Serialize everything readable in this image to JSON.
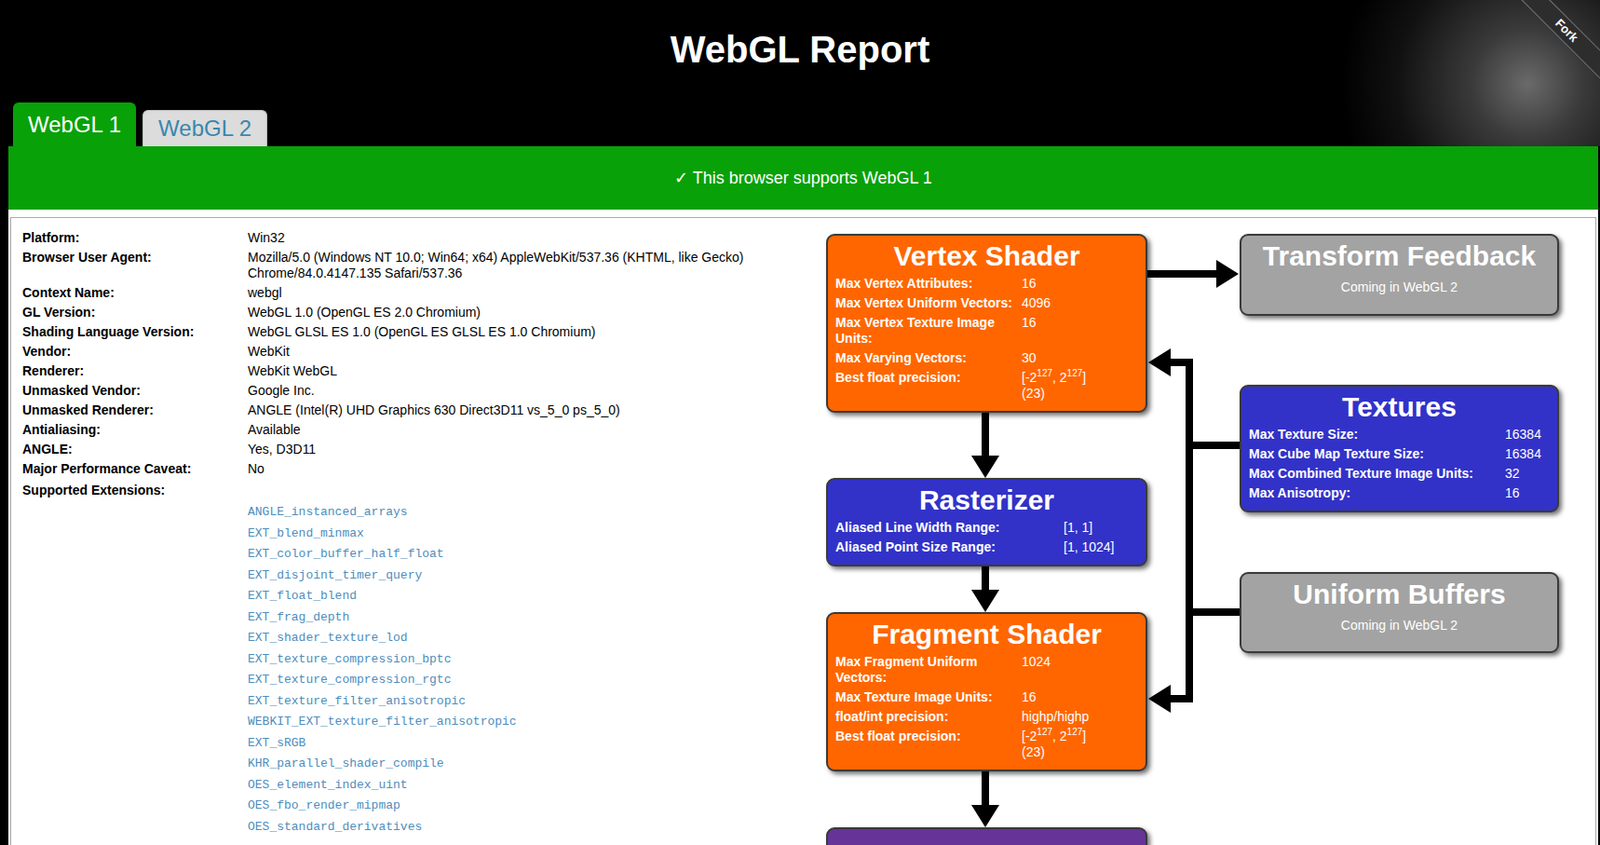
{
  "page": {
    "title": "WebGL Report",
    "ribbon": "Fork"
  },
  "tabs": [
    {
      "label": "WebGL 1",
      "selected": true
    },
    {
      "label": "WebGL 2",
      "selected": false
    }
  ],
  "banner": "✓ This browser supports WebGL 1",
  "info": [
    {
      "label": "Platform:",
      "value": "Win32"
    },
    {
      "label": "Browser User Agent:",
      "value": "Mozilla/5.0 (Windows NT 10.0; Win64; x64) AppleWebKit/537.36 (KHTML, like Gecko) Chrome/84.0.4147.135 Safari/537.36"
    },
    {
      "label": "Context Name:",
      "value": "webgl"
    },
    {
      "label": "GL Version:",
      "value": "WebGL 1.0 (OpenGL ES 2.0 Chromium)"
    },
    {
      "label": "Shading Language Version:",
      "value": "WebGL GLSL ES 1.0 (OpenGL ES GLSL ES 1.0 Chromium)"
    },
    {
      "label": "Vendor:",
      "value": "WebKit"
    },
    {
      "label": "Renderer:",
      "value": "WebKit WebGL"
    },
    {
      "label": "Unmasked Vendor:",
      "value": "Google Inc."
    },
    {
      "label": "Unmasked Renderer:",
      "value": "ANGLE (Intel(R) UHD Graphics 630 Direct3D11 vs_5_0 ps_5_0)"
    },
    {
      "label": "Antialiasing:",
      "value": "Available"
    },
    {
      "label": "ANGLE:",
      "value": "Yes, D3D11"
    },
    {
      "label": "Major Performance Caveat:",
      "value": "No"
    }
  ],
  "extensions_label": "Supported Extensions:",
  "extensions": [
    "ANGLE_instanced_arrays",
    "EXT_blend_minmax",
    "EXT_color_buffer_half_float",
    "EXT_disjoint_timer_query",
    "EXT_float_blend",
    "EXT_frag_depth",
    "EXT_shader_texture_lod",
    "EXT_texture_compression_bptc",
    "EXT_texture_compression_rgtc",
    "EXT_texture_filter_anisotropic",
    "WEBKIT_EXT_texture_filter_anisotropic",
    "EXT_sRGB",
    "KHR_parallel_shader_compile",
    "OES_element_index_uint",
    "OES_fbo_render_mipmap",
    "OES_standard_derivatives"
  ],
  "diagram": {
    "nodes": [
      {
        "title": "Vertex Shader",
        "color": "#ff6600",
        "rows": [
          {
            "label": "Max Vertex Attributes:",
            "value": "16"
          },
          {
            "label": "Max Vertex Uniform Vectors:",
            "value": "4096"
          },
          {
            "label": "Max Vertex Texture Image Units:",
            "value": "16"
          },
          {
            "label": "Max Varying Vectors:",
            "value": "30"
          },
          {
            "label": "Best float precision:",
            "parts": [
              {
                "text": "[-2",
                "sup": false
              },
              {
                "text": "127",
                "sup": true
              },
              {
                "text": ", 2",
                "sup": false
              },
              {
                "text": "127",
                "sup": true
              },
              {
                "text": "]",
                "sup": false
              },
              {
                "text": "(23)",
                "sup": false
              }
            ]
          }
        ]
      },
      {
        "title": "Transform Feedback",
        "color": "#a3a3a3",
        "note": "Coming in WebGL 2",
        "rows": []
      },
      {
        "title": "Textures",
        "color": "#3232c8",
        "rows": [
          {
            "label": "Max Texture Size:",
            "value": "16384"
          },
          {
            "label": "Max Cube Map Texture Size:",
            "value": "16384"
          },
          {
            "label": "Max Combined Texture Image Units:",
            "value": "32"
          },
          {
            "label": "Max Anisotropy:",
            "value": "16"
          }
        ]
      },
      {
        "title": "Uniform Buffers",
        "color": "#a3a3a3",
        "note": "Coming in WebGL 2",
        "rows": []
      },
      {
        "title": "Rasterizer",
        "color": "#3232c8",
        "rows": [
          {
            "label": "Aliased Line Width Range:",
            "value": "[1, 1]"
          },
          {
            "label": "Aliased Point Size Range:",
            "value": "[1, 1024]"
          }
        ]
      },
      {
        "title": "Fragment Shader",
        "color": "#ff6600",
        "rows": [
          {
            "label": "Max Fragment Uniform Vectors:",
            "value": "1024"
          },
          {
            "label": "Max Texture Image Units:",
            "value": "16"
          },
          {
            "label": "float/int precision:",
            "value": "highp/highp"
          },
          {
            "label": "Best float precision:",
            "parts": [
              {
                "text": "[-2",
                "sup": false
              },
              {
                "text": "127",
                "sup": true
              },
              {
                "text": ", 2",
                "sup": false
              },
              {
                "text": "127",
                "sup": true
              },
              {
                "text": "]",
                "sup": false
              },
              {
                "text": "(23)",
                "sup": false
              }
            ]
          }
        ]
      },
      {
        "color": "#663399",
        "rows": []
      }
    ]
  }
}
